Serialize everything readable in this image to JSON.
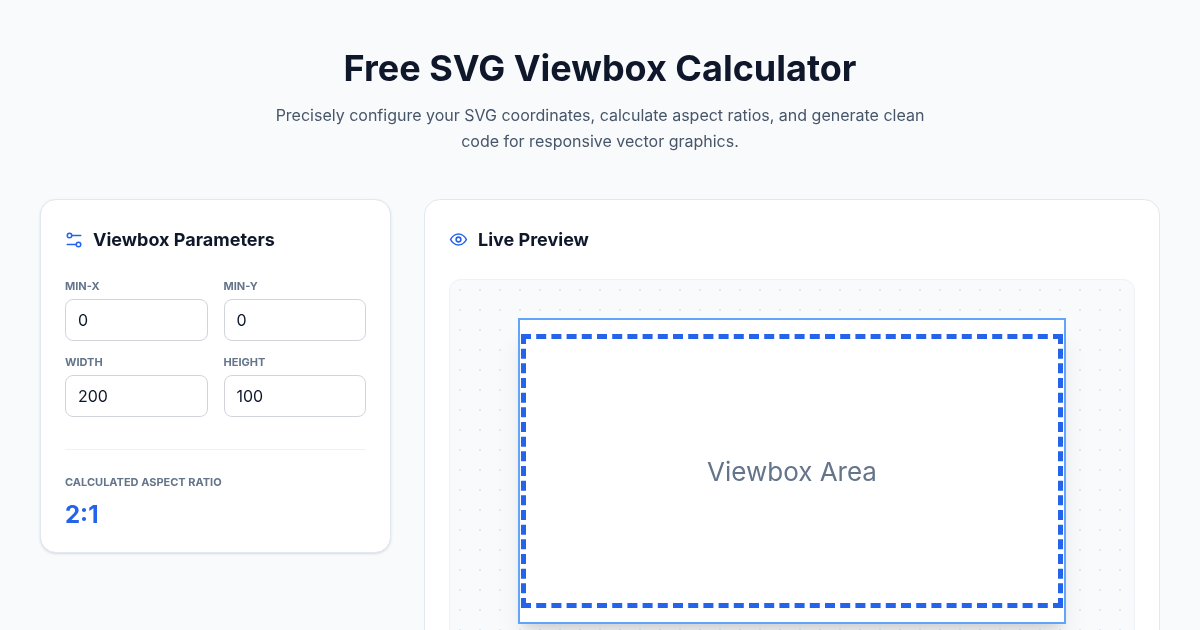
{
  "header": {
    "title": "Free SVG Viewbox Calculator",
    "subtitle": "Precisely configure your SVG coordinates, calculate aspect ratios, and generate clean code for responsive vector graphics."
  },
  "parameters": {
    "title": "Viewbox Parameters",
    "fields": [
      {
        "label": "MIN-X",
        "value": "0"
      },
      {
        "label": "MIN-Y",
        "value": "0"
      },
      {
        "label": "WIDTH",
        "value": "200"
      },
      {
        "label": "HEIGHT",
        "value": "100"
      }
    ],
    "ratio_label": "CALCULATED ASPECT RATIO",
    "ratio_value": "2:1"
  },
  "preview": {
    "title": "Live Preview",
    "area_label": "Viewbox Area"
  }
}
